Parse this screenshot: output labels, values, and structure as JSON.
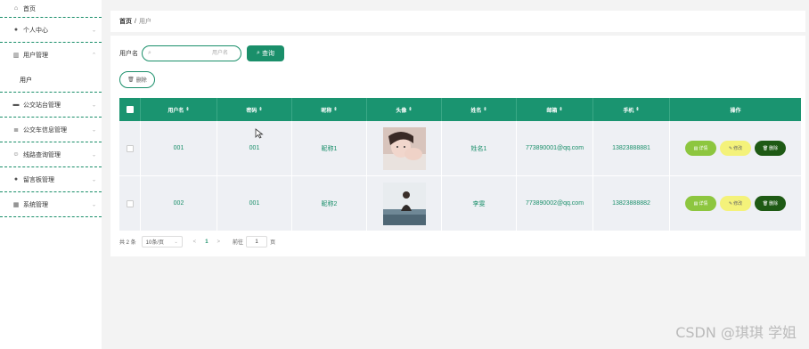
{
  "sidebar": {
    "items": [
      {
        "label": "首页",
        "icon": "home-icon",
        "glyph": "⌂"
      },
      {
        "label": "个人中心",
        "icon": "user-icon",
        "glyph": "●",
        "chevron": "⌄"
      },
      {
        "label": "用户管理",
        "icon": "chart-icon",
        "glyph": "▥",
        "chevron": "⌃"
      },
      {
        "label": "用户",
        "sub": true
      },
      {
        "label": "公交站台管理",
        "icon": "monitor-icon",
        "glyph": "▬",
        "chevron": "⌄"
      },
      {
        "label": "公交车信息管理",
        "icon": "list-icon",
        "glyph": "≣",
        "chevron": "⌄"
      },
      {
        "label": "线路查询管理",
        "icon": "smile-icon",
        "glyph": "☺",
        "chevron": "⌄"
      },
      {
        "label": "留言板管理",
        "icon": "pin-icon",
        "glyph": "●",
        "chevron": "⌄"
      },
      {
        "label": "系统管理",
        "icon": "building-icon",
        "glyph": "▦",
        "chevron": "⌄"
      }
    ]
  },
  "breadcrumb": {
    "home": "首页",
    "sep": "/",
    "current": "用户"
  },
  "search": {
    "label": "用户名",
    "placeholder": "用户名",
    "value": "",
    "button": "查询",
    "button_icon": "search-icon"
  },
  "toolbar": {
    "delete_label": "删除",
    "delete_icon": "trash-icon"
  },
  "table": {
    "columns": [
      "用户名",
      "密码",
      "昵称",
      "头像",
      "姓名",
      "邮箱",
      "手机",
      "操作"
    ],
    "sort_glyph": "⇕",
    "rows": [
      {
        "username": "001",
        "password": "001",
        "nickname": "昵称1",
        "name": "姓名1",
        "email": "773890001@qq.com",
        "phone": "13823888881"
      },
      {
        "username": "002",
        "password": "001",
        "nickname": "昵称2",
        "name": "李雯",
        "email": "773890002@qq.com",
        "phone": "13823888882"
      }
    ],
    "actions": {
      "detail": "详情",
      "edit": "修改",
      "delete": "删除"
    }
  },
  "pagination": {
    "total": "共 2 条",
    "page_size": "10条/页",
    "prev": "<",
    "current_page": "1",
    "next": ">",
    "goto_label": "前往",
    "goto_value": "1",
    "goto_unit": "页"
  },
  "watermark": "CSDN @琪琪 学姐",
  "colors": {
    "primary": "#1a8f6a",
    "header": "#1a9470",
    "detail": "#8dc63f",
    "edit": "#f4f27a",
    "delete": "#1e5a14"
  }
}
